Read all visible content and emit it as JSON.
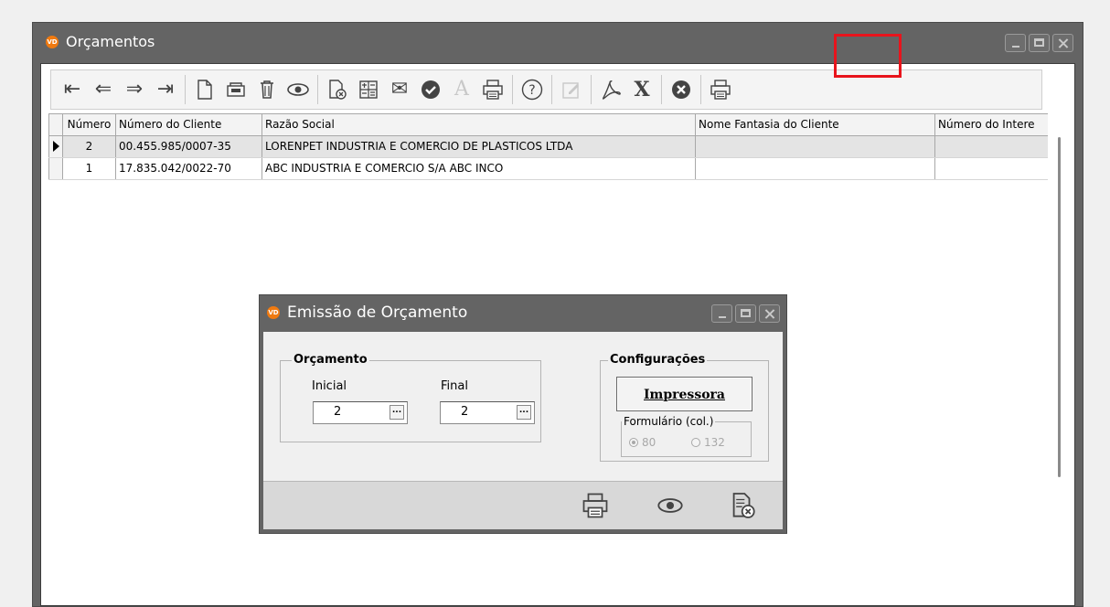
{
  "main_window": {
    "logo": "VD",
    "title": "Orçamentos"
  },
  "toolbar": {
    "buttons": [
      {
        "name": "first-record-icon",
        "glyph": "⇤"
      },
      {
        "name": "previous-record-icon",
        "glyph": "⇐"
      },
      {
        "name": "next-record-icon",
        "glyph": "⇒"
      },
      {
        "name": "last-record-icon",
        "glyph": "⇥"
      },
      {
        "name": "new-document-icon"
      },
      {
        "name": "edit-icon"
      },
      {
        "name": "delete-icon"
      },
      {
        "name": "view-icon"
      },
      {
        "name": "document-cancel-icon"
      },
      {
        "name": "calculator-icon"
      },
      {
        "name": "mail-icon",
        "glyph": "✉"
      },
      {
        "name": "check-circle-icon",
        "glyph": "✔"
      },
      {
        "name": "font-icon",
        "glyph": "A"
      },
      {
        "name": "print-icon"
      },
      {
        "name": "help-icon",
        "glyph": "?"
      },
      {
        "name": "edit-disabled-icon"
      },
      {
        "name": "pdf-icon"
      },
      {
        "name": "excel-icon",
        "glyph": "X"
      },
      {
        "name": "close-circle-icon",
        "glyph": "✖"
      },
      {
        "name": "print-budget-icon"
      }
    ],
    "highlight_color": "#e8141c"
  },
  "grid": {
    "columns": [
      "Número",
      "Número do Cliente",
      "Razão Social",
      "Nome Fantasia do Cliente",
      "Número do Intere"
    ],
    "rows": [
      {
        "numero": "2",
        "cliente": "00.455.985/0007-35",
        "razao": "LORENPET INDUSTRIA E COMERCIO DE PLASTICOS LTDA",
        "fantasia": "",
        "interessado": ""
      },
      {
        "numero": "1",
        "cliente": "17.835.042/0022-70",
        "razao": "ABC INDUSTRIA E COMERCIO S/A ABC INCO",
        "fantasia": "",
        "interessado": ""
      }
    ]
  },
  "dialog": {
    "logo": "VD",
    "title": "Emissão de Orçamento",
    "orcamento_group": {
      "legend": "Orçamento",
      "initial_label": "Inicial",
      "initial_value": "2",
      "final_label": "Final",
      "final_value": "2",
      "ellipsis": "..."
    },
    "config_group": {
      "legend": "Configurações",
      "printer_button": "Impressora",
      "form_group_legend": "Formulário (col.)",
      "option_80": "80",
      "option_132": "132",
      "selected": "80"
    },
    "footer_icons": [
      "print-icon",
      "preview-icon",
      "cancel-icon"
    ]
  },
  "colors": {
    "window_frame": "#646464",
    "title_text": "#ffffff",
    "logo_orange": "#f07a10",
    "dialog_body": "#f0f0f0",
    "footer": "#d8d8d8"
  }
}
